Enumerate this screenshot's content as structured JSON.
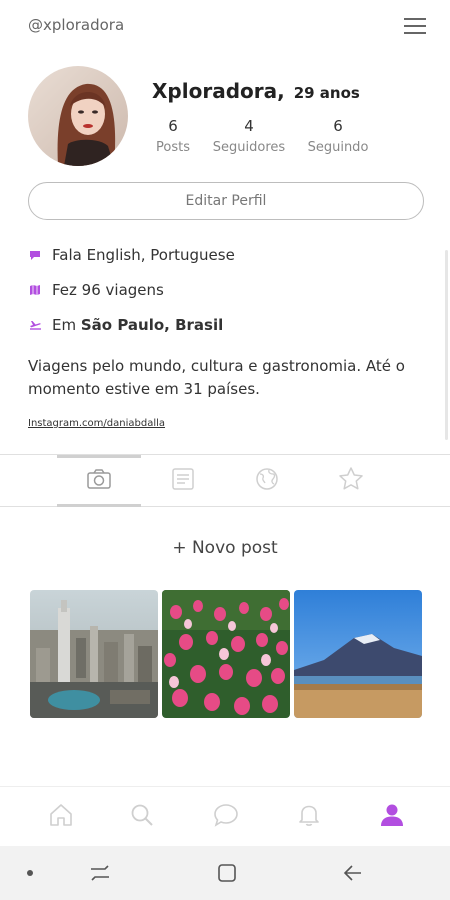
{
  "header": {
    "username": "@xploradora",
    "menu_icon": "hamburger-icon"
  },
  "profile": {
    "name": "Xploradora,",
    "age": "29 anos",
    "stats": [
      {
        "value": "6",
        "label": "Posts"
      },
      {
        "value": "4",
        "label": "Seguidores"
      },
      {
        "value": "6",
        "label": "Seguindo"
      }
    ],
    "edit_button": "Editar Perfil"
  },
  "info": {
    "languages": "Fala English, Portuguese",
    "trips": "Fez 96 viagens",
    "location_prefix": "Em",
    "location": "São Paulo, Brasil"
  },
  "bio": "Viagens pelo mundo, cultura e gastronomia. Até o momento estive em 31 países.",
  "link": "Instagram.com/daniabdalla",
  "tabs": [
    {
      "icon": "camera-icon",
      "active": true
    },
    {
      "icon": "notes-icon",
      "active": false
    },
    {
      "icon": "globe-icon",
      "active": false
    },
    {
      "icon": "star-icon",
      "active": false
    }
  ],
  "new_post": "+ Novo post",
  "bottom_nav": [
    {
      "icon": "home-icon"
    },
    {
      "icon": "search-icon"
    },
    {
      "icon": "chat-icon"
    },
    {
      "icon": "bell-icon"
    },
    {
      "icon": "user-icon",
      "active": true
    }
  ],
  "colors": {
    "accent": "#b24ee0",
    "muted_icon": "#c9c9c9",
    "text": "#333333"
  }
}
